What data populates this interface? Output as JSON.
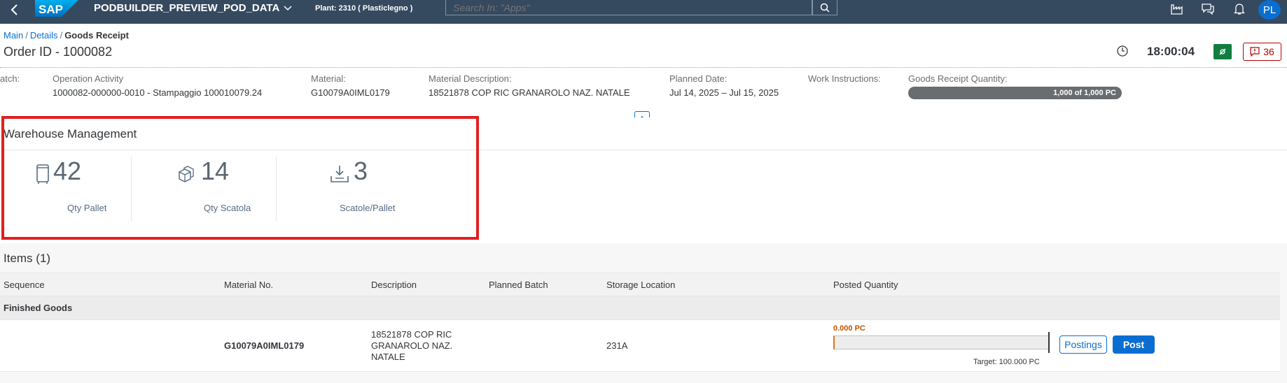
{
  "shell": {
    "back_icon": "chevron-left-icon",
    "logo_text": "SAP",
    "app_title": "PODBUILDER_PREVIEW_POD_DATA",
    "plant": "Plant: 2310 ( Plasticlegno )",
    "search_placeholder": "Search In: \"Apps\"",
    "avatar_initials": "PL",
    "colors": {
      "shell_bg": "#354a5f",
      "avatar_bg": "#0a6ed1"
    }
  },
  "header": {
    "breadcrumb": [
      "Main",
      "Details"
    ],
    "breadcrumb_current": "Goods Receipt",
    "order_title": "Order ID - 1000082",
    "time": "18:00:04",
    "alert_count": "36"
  },
  "attributes": [
    {
      "label": "atch:",
      "value": ""
    },
    {
      "label": "Operation Activity",
      "value": "1000082-000000-0010 - Stampaggio 100010079.24"
    },
    {
      "label": "Material:",
      "value": "G10079A0IML0179"
    },
    {
      "label": "Material Description:",
      "value": "18521878 COP RIC GRANAROLO NAZ. NATALE"
    },
    {
      "label": "Planned Date:",
      "value": "Jul 14, 2025 – Jul 15, 2025"
    },
    {
      "label": "Work Instructions:",
      "value": ""
    },
    {
      "label": "Goods Receipt Quantity:",
      "value": ""
    }
  ],
  "gr_progress": {
    "text": "1,000 of 1,000 PC",
    "fraction": 1.0
  },
  "warehouse": {
    "title": "Warehouse Management",
    "tiles": [
      {
        "icon": "pallet-icon",
        "value": "42",
        "caption": "Qty Pallet"
      },
      {
        "icon": "boxes-icon",
        "value": "14",
        "caption": "Qty Scatola"
      },
      {
        "icon": "download-tray-icon",
        "value": "3",
        "caption": "Scatole/Pallet"
      }
    ]
  },
  "items": {
    "title": "Items (1)",
    "columns": [
      "Sequence",
      "Material No.",
      "Description",
      "Planned Batch",
      "Storage Location",
      "Posted Quantity"
    ],
    "group": "Finished Goods",
    "rows": [
      {
        "sequence": "",
        "material_no": "G10079A0IML0179",
        "description": "18521878 COP RIC GRANAROLO NAZ. NATALE",
        "planned_batch": "",
        "storage_location": "231A",
        "posted_quantity": "0.000 PC",
        "target": "Target: 100.000 PC",
        "progress_fraction": 0.0,
        "postings_label": "Postings",
        "post_label": "Post"
      }
    ]
  }
}
